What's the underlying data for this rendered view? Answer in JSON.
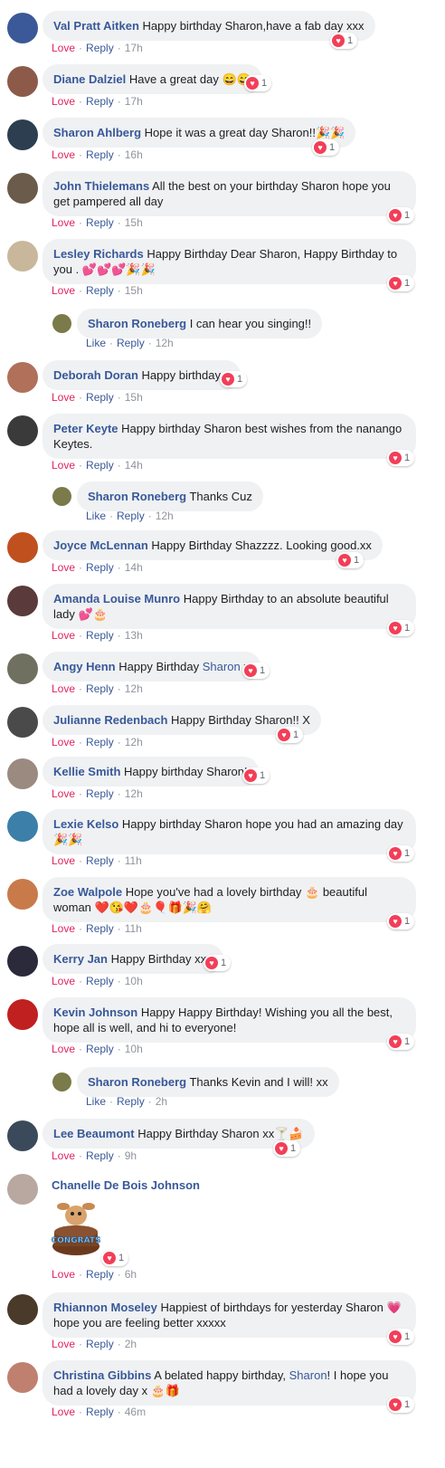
{
  "comments": [
    {
      "author": "Val Pratt Aitken",
      "text": "Happy birthday Sharon,have a fab day xxx",
      "time": "17h",
      "reactions": "1",
      "action1": "Love",
      "avatar_color": "#3b5998"
    },
    {
      "author": "Diane Dalziel",
      "text": "Have a great day 😄😄",
      "time": "17h",
      "reactions": "1",
      "action1": "Love",
      "avatar_color": "#8d5a4a"
    },
    {
      "author": "Sharon Ahlberg",
      "text": "Hope it was a great day Sharon!!🎉🎉",
      "time": "16h",
      "reactions": "1",
      "action1": "Love",
      "avatar_color": "#2c3e50"
    },
    {
      "author": "John Thielemans",
      "text": "All the best on your birthday Sharon hope you get pampered all day",
      "time": "15h",
      "reactions": "1",
      "action1": "Love",
      "avatar_color": "#6b5b4b"
    },
    {
      "author": "Lesley Richards",
      "text": "Happy Birthday Dear Sharon, Happy Birthday to you . 💕💕💕🎉🎉",
      "time": "15h",
      "reactions": "1",
      "action1": "Love",
      "avatar_color": "#c9b79c"
    },
    {
      "author": "Sharon Roneberg",
      "text": "I can hear you singing!!",
      "time": "12h",
      "action1": "Like",
      "avatar_color": "#7a7a4a"
    },
    {
      "author": "Deborah Doran",
      "text": "Happy birthday x",
      "time": "15h",
      "reactions": "1",
      "action1": "Love",
      "avatar_color": "#b0705a"
    },
    {
      "author": "Peter Keyte",
      "text": "Happy birthday Sharon best wishes from the nanango Keytes.",
      "time": "14h",
      "reactions": "1",
      "action1": "Love",
      "avatar_color": "#3a3a3a"
    },
    {
      "author": "Sharon Roneberg",
      "text": "Thanks Cuz",
      "time": "12h",
      "action1": "Like",
      "avatar_color": "#7a7a4a"
    },
    {
      "author": "Joyce McLennan",
      "text": "Happy Birthday Shazzzz. Looking good.xx",
      "time": "14h",
      "reactions": "1",
      "action1": "Love",
      "avatar_color": "#c0501e"
    },
    {
      "author": "Amanda Louise Munro",
      "text": "Happy Birthday to an absolute beautiful lady 💕🎂",
      "time": "13h",
      "reactions": "1",
      "action1": "Love",
      "avatar_color": "#5a3a3a"
    },
    {
      "author": "Angy Henn",
      "text_before": "Happy Birthday ",
      "mention": "Sharon",
      "text_after": " x",
      "time": "12h",
      "reactions": "1",
      "action1": "Love",
      "avatar_color": "#707060"
    },
    {
      "author": "Julianne Redenbach",
      "text": "Happy Birthday Sharon!! X",
      "time": "12h",
      "reactions": "1",
      "action1": "Love",
      "avatar_color": "#4a4a4a"
    },
    {
      "author": "Kellie Smith",
      "text": "Happy birthday Sharon!",
      "time": "12h",
      "reactions": "1",
      "action1": "Love",
      "avatar_color": "#9a8a80"
    },
    {
      "author": "Lexie Kelso",
      "text": "Happy birthday Sharon hope you had an amazing day 🎉🎉",
      "time": "11h",
      "reactions": "1",
      "action1": "Love",
      "avatar_color": "#3c7fa8"
    },
    {
      "author": "Zoe Walpole",
      "text": "Hope you've had a lovely birthday 🎂 beautiful woman ❤️😘❤️🎂🎈🎁🎉🤗",
      "time": "11h",
      "reactions": "1",
      "action1": "Love",
      "avatar_color": "#c97a4a"
    },
    {
      "author": "Kerry Jan",
      "text": "Happy Birthday xxx",
      "time": "10h",
      "reactions": "1",
      "action1": "Love",
      "avatar_color": "#2a2a3a"
    },
    {
      "author": "Kevin Johnson",
      "text": "Happy Happy Birthday! Wishing you all the best, hope all is well, and hi to everyone!",
      "time": "10h",
      "reactions": "1",
      "action1": "Love",
      "avatar_color": "#c02020"
    },
    {
      "author": "Sharon Roneberg",
      "text": "Thanks Kevin and I will! xx",
      "time": "2h",
      "action1": "Like",
      "avatar_color": "#7a7a4a"
    },
    {
      "author": "Lee Beaumont",
      "text": "Happy Birthday Sharon xx🍸🍰",
      "time": "9h",
      "reactions": "1",
      "action1": "Love",
      "avatar_color": "#3a4a5a"
    },
    {
      "author": "Chanelle De Bois Johnson",
      "text": "",
      "time": "6h",
      "reactions": "1",
      "action1": "Love",
      "avatar_color": "#b8a8a0",
      "sticker": "CONGRATS"
    },
    {
      "author": "Rhiannon Moseley",
      "text": "Happiest of birthdays for yesterday Sharon 💗 hope you are feeling better xxxxx",
      "time": "2h",
      "reactions": "1",
      "action1": "Love",
      "avatar_color": "#4a3a2a"
    },
    {
      "author": "Christina Gibbins",
      "text_before": "A belated happy birthday, ",
      "mention": "Sharon",
      "text_after": "! I hope you had a lovely day x 🎂🎁",
      "time": "46m",
      "reactions": "1",
      "action1": "Love",
      "avatar_color": "#c08070"
    }
  ],
  "ui": {
    "reply_label": "Reply",
    "love_label": "Love",
    "like_label": "Like",
    "heart_glyph": "♥",
    "accent": "#385898",
    "love_color": "#e0245e"
  }
}
